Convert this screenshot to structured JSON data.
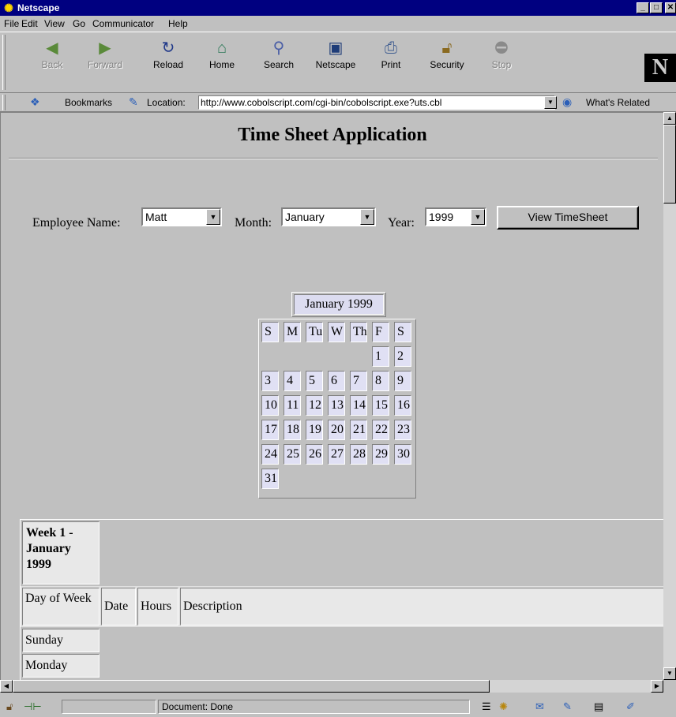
{
  "window": {
    "title": "Netscape"
  },
  "menu": [
    "File",
    "Edit",
    "View",
    "Go",
    "Communicator",
    "Help"
  ],
  "toolbar": [
    {
      "label": "Back",
      "icon": "back-arrow-icon",
      "enabled": false
    },
    {
      "label": "Forward",
      "icon": "forward-arrow-icon",
      "enabled": false
    },
    {
      "label": "Reload",
      "icon": "reload-icon",
      "enabled": true
    },
    {
      "label": "Home",
      "icon": "home-icon",
      "enabled": true
    },
    {
      "label": "Search",
      "icon": "search-icon",
      "enabled": true
    },
    {
      "label": "Netscape",
      "icon": "my-netscape-icon",
      "enabled": true
    },
    {
      "label": "Print",
      "icon": "print-icon",
      "enabled": true
    },
    {
      "label": "Security",
      "icon": "security-lock-icon",
      "enabled": true
    },
    {
      "label": "Stop",
      "icon": "stop-icon",
      "enabled": false
    }
  ],
  "logo_text": "N",
  "location_bar": {
    "bookmarks_label": "Bookmarks",
    "location_label": "Location:",
    "url": "http://www.cobolscript.com/cgi-bin/cobolscript.exe?uts.cbl",
    "related_label": "What's Related"
  },
  "page": {
    "title": "Time Sheet Application",
    "employee_label": "Employee Name:",
    "employee_value": "Matt",
    "month_label": "Month:",
    "month_value": "January",
    "year_label": "Year:",
    "year_value": "1999",
    "view_button": "View TimeSheet"
  },
  "calendar": {
    "caption": "January 1999",
    "day_headers": [
      "S",
      "M",
      "Tu",
      "W",
      "Th",
      "F",
      "S"
    ],
    "weeks": [
      [
        "",
        "",
        "",
        "",
        "",
        "1",
        "2"
      ],
      [
        "3",
        "4",
        "5",
        "6",
        "7",
        "8",
        "9"
      ],
      [
        "10",
        "11",
        "12",
        "13",
        "14",
        "15",
        "16"
      ],
      [
        "17",
        "18",
        "19",
        "20",
        "21",
        "22",
        "23"
      ],
      [
        "24",
        "25",
        "26",
        "27",
        "28",
        "29",
        "30"
      ],
      [
        "31",
        "",
        "",
        "",
        "",
        "",
        ""
      ]
    ]
  },
  "week_table": {
    "heading": "Week 1 - January 1999",
    "columns": [
      "Day of Week",
      "Date",
      "Hours",
      "Description"
    ],
    "days": [
      "Sunday",
      "Monday"
    ]
  },
  "status": {
    "text": "Document: Done"
  },
  "colors": {
    "titlebar": "#000080",
    "window": "#c0c0c0",
    "calendar_cell": "#e0e0f4"
  }
}
